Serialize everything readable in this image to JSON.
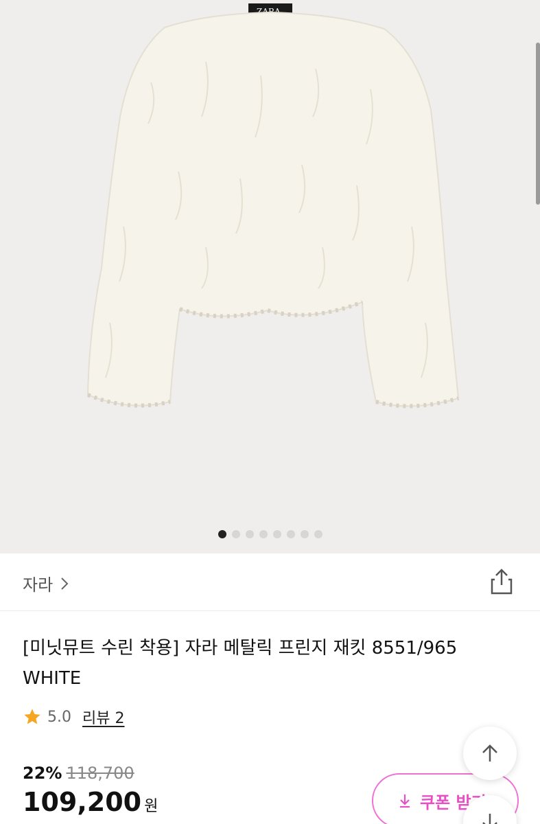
{
  "gallery": {
    "image_label": "ZARA",
    "dots_total": 8,
    "active_dot": 1
  },
  "brand": {
    "name": "자라"
  },
  "product": {
    "title": "[미닛뮤트 수린 착용] 자라 메탈릭 프린지 재킷 8551/965 WHITE",
    "rating": "5.0",
    "reviews_label": "리뷰 2"
  },
  "pricing": {
    "discount": "22%",
    "original": "118,700",
    "price": "109,200",
    "currency": "원"
  },
  "coupon": {
    "label": "쿠폰 받기"
  },
  "colors": {
    "accent": "#e94fc5",
    "star": "#f5a623"
  }
}
